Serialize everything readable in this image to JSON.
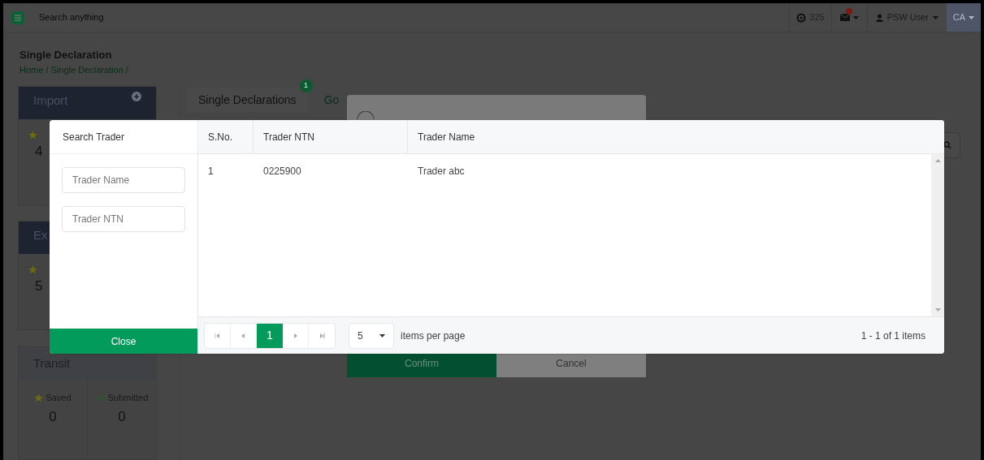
{
  "top_bar": {
    "search_placeholder": "Search anything",
    "counter": "325",
    "user": "PSW User",
    "locale": "CA"
  },
  "page": {
    "title": "Single Declaration",
    "breadcrumb": "Home / Single Declaration /"
  },
  "sidebar": [
    {
      "title": "Import",
      "stats": [
        {
          "kind": "saved",
          "value": "4"
        }
      ]
    },
    {
      "title": "Ex",
      "stats": [
        {
          "kind": "saved",
          "value": "5"
        }
      ]
    },
    {
      "title": "Transit",
      "stats": [
        {
          "kind": "saved",
          "label": "Saved",
          "value": "0"
        },
        {
          "kind": "submitted",
          "label": "Submitted",
          "value": "0"
        }
      ]
    }
  ],
  "tabs": [
    {
      "label": "Single Declarations",
      "badge": "1",
      "selected": true
    },
    {
      "label": "Go",
      "selected": false
    }
  ],
  "confirm_dialog": {
    "buttons": [
      {
        "label": "Confirm",
        "kind": "primary"
      },
      {
        "label": "Cancel",
        "kind": "secondary"
      }
    ]
  },
  "trader_dialog": {
    "search_title": "Search Trader",
    "fields": [
      {
        "placeholder": "Trader Name"
      },
      {
        "placeholder": "Trader NTN"
      }
    ],
    "close_button": "Close",
    "table": {
      "columns": [
        "S.No.",
        "Trader NTN",
        "Trader Name"
      ],
      "rows": [
        [
          "1",
          "0225900",
          "Trader abc"
        ]
      ]
    },
    "pager": {
      "pages": [
        {
          "label": "1",
          "selected": true
        }
      ],
      "page_size": "5",
      "page_size_label": "items per page",
      "summary": "1 - 1 of 1 items"
    }
  }
}
